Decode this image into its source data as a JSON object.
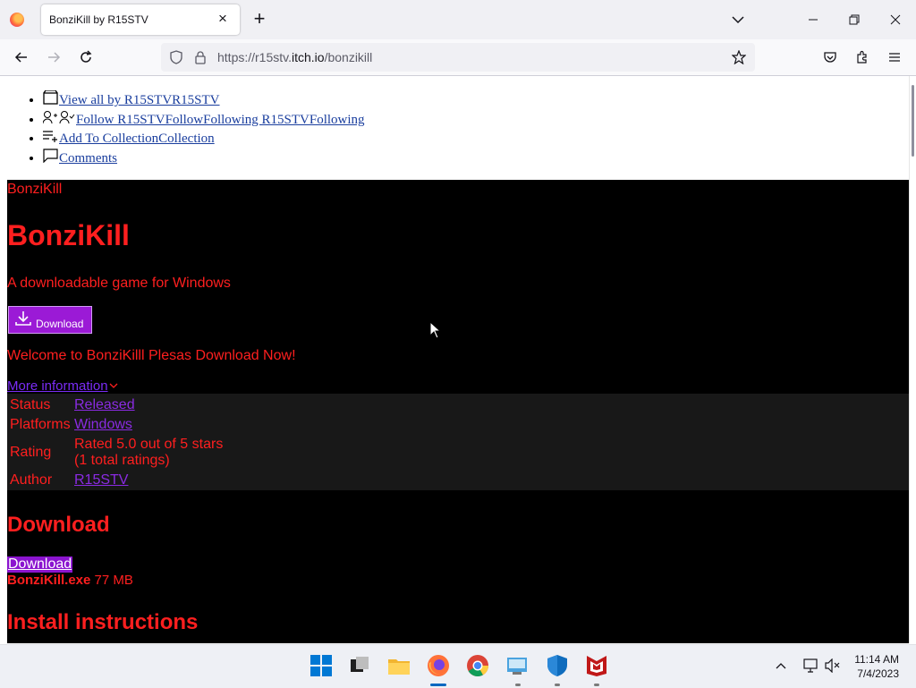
{
  "browser": {
    "tab_title": "BonziKill by R15STV",
    "url_prefix": "https://r15stv.",
    "url_domain": "itch.io",
    "url_path": "/bonzikill"
  },
  "user_links": [
    {
      "label": "View all by R15STVR15STV"
    },
    {
      "label": "Follow R15STVFollowFollowing R15STVFollowing"
    },
    {
      "label": "Add To CollectionCollection"
    },
    {
      "label": "Comments"
    }
  ],
  "game": {
    "small_title": "BonziKill",
    "title": "BonziKill",
    "subtitle": "A downloadable game for Windows",
    "download_button": "Download",
    "welcome": "Welcome to BonziKilll Plesas Download Now!",
    "more_info": "More information",
    "info": {
      "status_label": "Status",
      "status_value": "Released",
      "platforms_label": "Platforms",
      "platforms_value": "Windows",
      "rating_label": "Rating",
      "rating_line1": "Rated 5.0 out of 5 stars",
      "rating_line2": "(1 total ratings)",
      "author_label": "Author",
      "author_value": "R15STV"
    },
    "download_heading": "Download",
    "download_link": "Download",
    "file_name": "BonziKill.exe",
    "file_size": "77 MB",
    "install_heading": "Install instructions"
  },
  "taskbar": {
    "time": "11:14 AM",
    "date": "7/4/2023"
  },
  "colors": {
    "page_bg": "#000000",
    "text_red": "#ff1f1f",
    "accent_purple": "#9b1ad6"
  }
}
